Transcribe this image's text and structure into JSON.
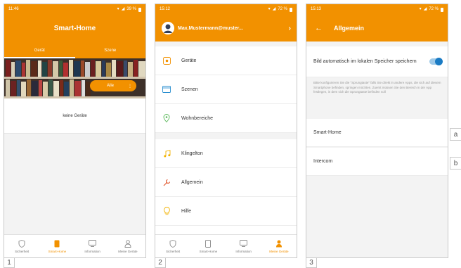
{
  "phone1": {
    "status": {
      "time": "11:46",
      "battery": "39 %"
    },
    "title": "Smart-Home",
    "tabs": [
      {
        "label": "Gerät"
      },
      {
        "label": "Szene"
      }
    ],
    "room_button": "Alle",
    "empty_text": "keine Geräte",
    "nav": [
      {
        "label": "Sicherheit"
      },
      {
        "label": "Smart-Home"
      },
      {
        "label": "Information"
      },
      {
        "label": "Meine Geräte"
      }
    ]
  },
  "phone2": {
    "status": {
      "time": "15:12",
      "battery": "72 %"
    },
    "user": "Max.Mustermann@muster...",
    "menu": [
      {
        "label": "Geräte",
        "icon": "devices-icon"
      },
      {
        "label": "Szenen",
        "icon": "scenes-icon"
      },
      {
        "label": "Wohnbereiche",
        "icon": "location-icon"
      },
      {
        "label": "Klingelton",
        "icon": "music-note-icon"
      },
      {
        "label": "Allgemein",
        "icon": "wrench-icon"
      },
      {
        "label": "Hilfe",
        "icon": "lightbulb-icon"
      }
    ],
    "nav": [
      {
        "label": "Sicherheit"
      },
      {
        "label": "Smart-Home"
      },
      {
        "label": "Information"
      },
      {
        "label": "Meine Geräte"
      }
    ]
  },
  "phone3": {
    "status": {
      "time": "15:13",
      "battery": "72 %"
    },
    "title": "Allgemein",
    "setting_label": "Bild automatisch im lokalen Speicher speichern",
    "toggle_on": true,
    "hint": "Bitte konfigurieren Sie die \"Sprungtaste\" falls Sie direkt in andere Apps, die sich auf diesem Smartphone befinden, springen möchten. Zuerst müssen Sie den Bereich in der App festlegen, in dem sich die Sprungtaste befinden soll",
    "items": [
      {
        "label": "Smart-Home"
      },
      {
        "label": "Intercom"
      }
    ]
  },
  "side_labels": [
    "a",
    "b"
  ],
  "screen_numbers": [
    "1",
    "2",
    "3"
  ],
  "colors": {
    "accent": "#f29100",
    "toggle": "#1a7bc4"
  }
}
